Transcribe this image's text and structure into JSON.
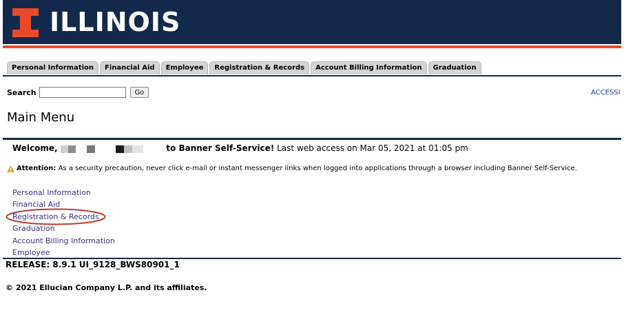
{
  "header": {
    "logo_text": "ILLINOIS",
    "logo_mark": "I"
  },
  "tabs": [
    {
      "label": "Personal Information"
    },
    {
      "label": "Financial Aid"
    },
    {
      "label": "Employee"
    },
    {
      "label": "Registration & Records"
    },
    {
      "label": "Account Billing Information"
    },
    {
      "label": "Graduation"
    }
  ],
  "search": {
    "label": "Search",
    "value": "",
    "button_label": "Go"
  },
  "accessibility_link": "ACCESSI",
  "page_title": "Main Menu",
  "welcome": {
    "prefix": "Welcome,",
    "suffix": "to Banner Self-Service!",
    "last_access": "Last web access on Mar 05, 2021 at 01:05 pm"
  },
  "attention": {
    "label": "Attention:",
    "text": "As a security precaution, never click e-mail or instant messenger links when logged into applications through a browser including Banner Self-Service."
  },
  "menu": [
    {
      "label": "Personal Information"
    },
    {
      "label": "Financial Aid"
    },
    {
      "label": "Registration & Records"
    },
    {
      "label": "Graduation"
    },
    {
      "label": "Account Billing Information"
    },
    {
      "label": "Employee"
    }
  ],
  "release": "RELEASE: 8.9.1 UI_9128_BWS80901_1",
  "copyright": "© 2021 Ellucian Company L.P. and its affiliates.",
  "colors": {
    "navy": "#13294b",
    "orange": "#e84a27",
    "link": "#3c2e8f",
    "highlight": "#c0392b"
  }
}
